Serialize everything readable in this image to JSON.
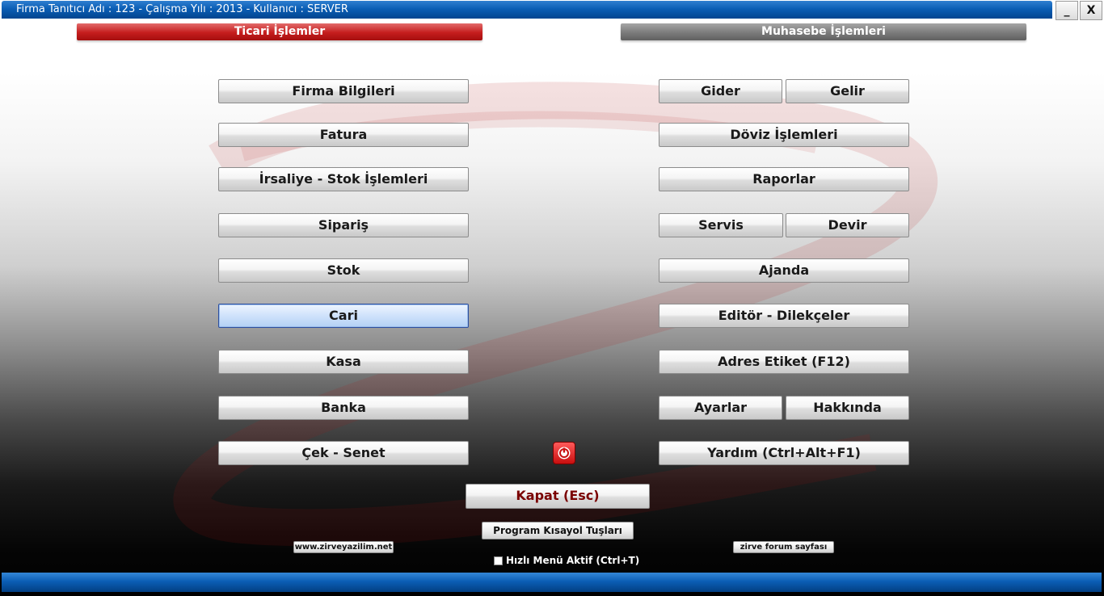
{
  "window": {
    "title": "Firma Tanıtıcı Adı : 123 - Çalışma Yılı : 2013 - Kullanıcı : SERVER",
    "minimize_label": "_",
    "close_label": "X"
  },
  "headers": {
    "ticari": "Ticari İşlemler",
    "muhasebe": "Muhasebe İşlemleri"
  },
  "ticari_buttons": {
    "firma": "Firma Bilgileri",
    "fatura": "Fatura",
    "irsaliye": "İrsaliye - Stok İşlemleri",
    "siparis": "Sipariş",
    "stok": "Stok",
    "cari": "Cari",
    "kasa": "Kasa",
    "banka": "Banka",
    "cek_senet": "Çek - Senet"
  },
  "muhasebe_buttons": {
    "gider": "Gider",
    "gelir": "Gelir",
    "doviz": "Döviz İşlemleri",
    "raporlar": "Raporlar",
    "servis": "Servis",
    "devir": "Devir",
    "ajanda": "Ajanda",
    "editor": "Editör - Dilekçeler",
    "adres_etiket": "Adres Etiket (F12)",
    "ayarlar": "Ayarlar",
    "hakkinda": "Hakkında",
    "yardim": "Yardım (Ctrl+Alt+F1)"
  },
  "bottom": {
    "kapat": "Kapat (Esc)",
    "kisayol": "Program Kısayol Tuşları",
    "website": "www.zirveyazilim.net",
    "forum": "zirve forum sayfası",
    "quick_menu_label": "Hızlı Menü Aktif (Ctrl+T)",
    "quick_menu_checked": false
  },
  "icons": {
    "power": "power-icon"
  },
  "colors": {
    "title_bar": "#0b5eb5",
    "ticari_header": "#c51d1d",
    "muhasebe_header": "#7b7b7b",
    "kapat_text": "#7a0000",
    "active_button": "#cfe2fb"
  }
}
